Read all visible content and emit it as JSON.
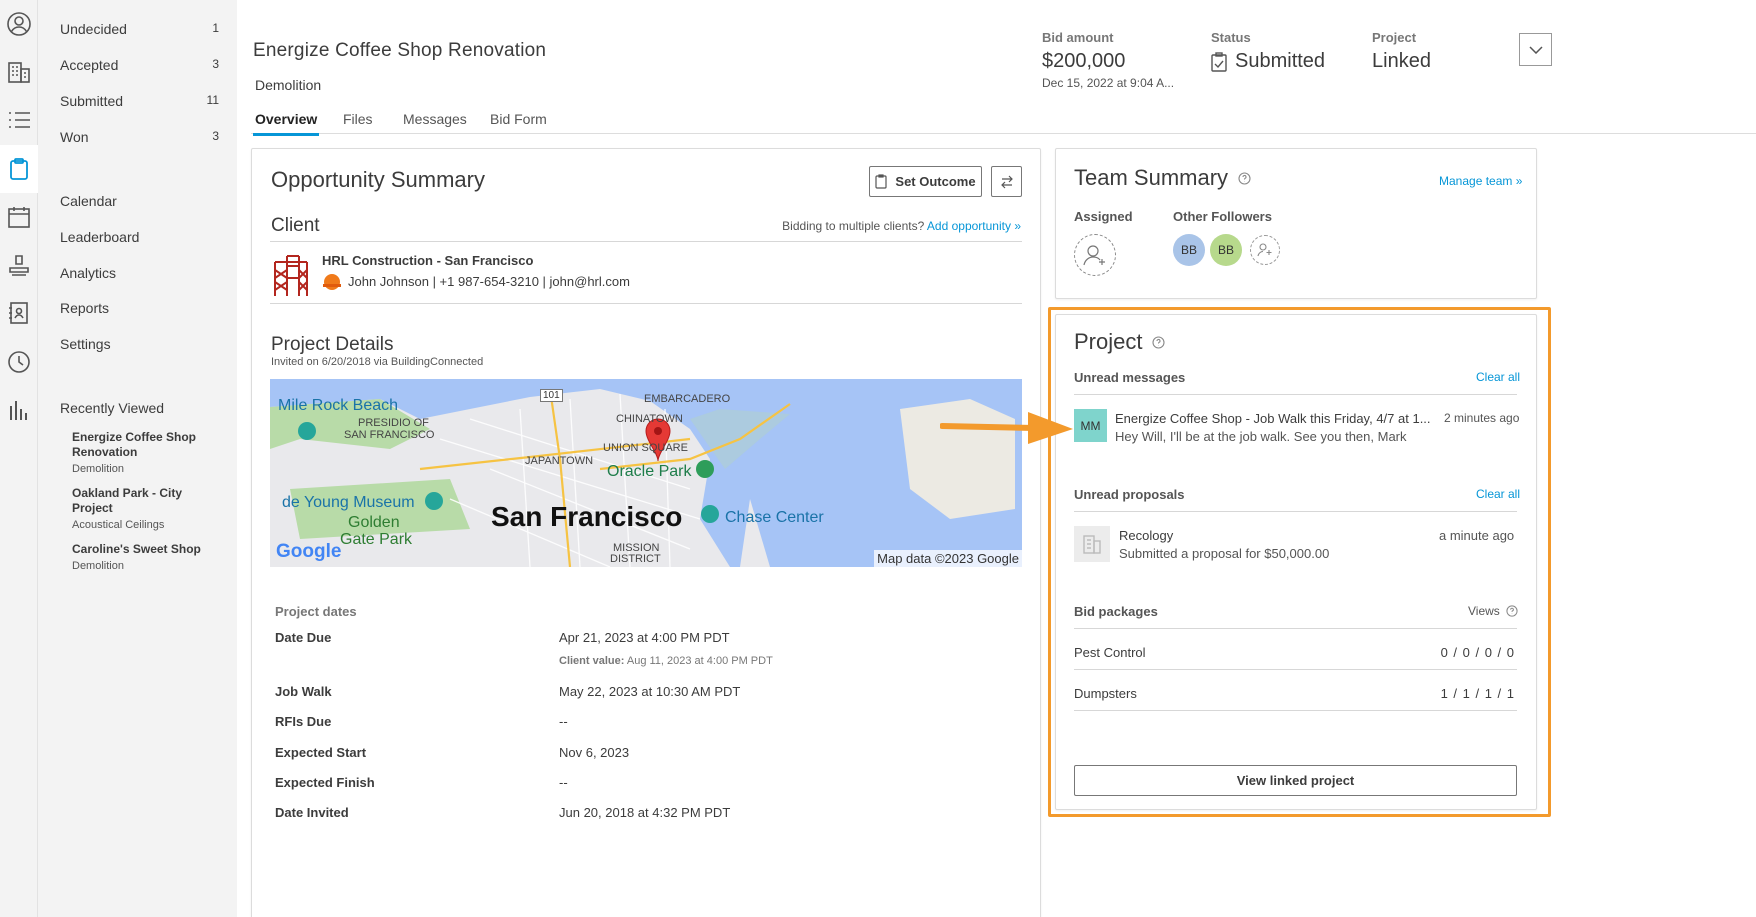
{
  "rail": {
    "icons": [
      "user-circle-icon",
      "building-icon",
      "list-icon",
      "clipboard-icon",
      "calendar-icon",
      "stamp-icon",
      "contacts-book-icon",
      "clock-icon",
      "bar-chart-icon"
    ]
  },
  "sidenav": {
    "items": [
      {
        "label": "Undecided",
        "count": "1"
      },
      {
        "label": "Accepted",
        "count": "3"
      },
      {
        "label": "Submitted",
        "count": "11"
      },
      {
        "label": "Won",
        "count": "3"
      }
    ],
    "links": [
      "Calendar",
      "Leaderboard",
      "Analytics",
      "Reports",
      "Settings"
    ],
    "recently_viewed_title": "Recently Viewed",
    "recent": [
      {
        "name": "Energize Coffee Shop Renovation",
        "sub": "Demolition"
      },
      {
        "name": "Oakland Park - City Project",
        "sub": "Acoustical Ceilings"
      },
      {
        "name": "Caroline's Sweet Shop",
        "sub": "Demolition"
      }
    ]
  },
  "header": {
    "title": "Energize Coffee Shop Renovation",
    "subtitle": "Demolition",
    "tabs": [
      "Overview",
      "Files",
      "Messages",
      "Bid Form"
    ],
    "bid_amount_label": "Bid amount",
    "bid_amount": "$200,000",
    "bid_date": "Dec 15, 2022 at 9:04 A...",
    "status_label": "Status",
    "status": "Submitted",
    "project_label": "Project",
    "project": "Linked"
  },
  "summary": {
    "title": "Opportunity Summary",
    "set_outcome": "Set Outcome",
    "client_heading": "Client",
    "multi_clients": "Bidding to multiple clients?",
    "add_opportunity": "Add opportunity »",
    "client_name": "HRL Construction - San Francisco",
    "contact": "John Johnson  |  +1 987-654-3210  |  john@hrl.com",
    "details_heading": "Project Details",
    "invited": "Invited on 6/20/2018 via BuildingConnected",
    "map": {
      "labels": [
        "Mile Rock Beach",
        "PRESIDIO OF",
        "SAN FRANCISCO",
        "EMBARCADERO",
        "CHINATOWN",
        "101",
        "JAPANTOWN",
        "UNION SQUARE",
        "Oracle Park",
        "de Young Museum",
        "Golden",
        "Gate Park",
        "San Francisco",
        "Chase Center",
        "MISSION",
        "DISTRICT"
      ],
      "attribution": "Map data ©2023 Google",
      "logo": "Google"
    },
    "dates_heading": "Project dates",
    "dates": [
      {
        "k": "Date Due",
        "v": "Apr 21, 2023 at 4:00 PM PDT"
      },
      {
        "k": "Job Walk",
        "v": "May 22, 2023 at 10:30 AM PDT"
      },
      {
        "k": "RFIs Due",
        "v": "--"
      },
      {
        "k": "Expected Start",
        "v": "Nov 6, 2023"
      },
      {
        "k": "Expected Finish",
        "v": "--"
      },
      {
        "k": "Date Invited",
        "v": "Jun 20, 2018 at 4:32 PM PDT"
      }
    ],
    "client_value_label": "Client value:",
    "client_value": "Aug 11, 2023 at 4:00 PM PDT"
  },
  "team": {
    "title": "Team Summary",
    "manage": "Manage team »",
    "assigned": "Assigned",
    "followers": "Other Followers",
    "avatars": [
      {
        "initials": "BB",
        "color": "#a9c4e8"
      },
      {
        "initials": "BB",
        "color": "#b7d98c"
      }
    ]
  },
  "project": {
    "title": "Project",
    "unread_messages": "Unread messages",
    "clear_all": "Clear all",
    "msg_avatar": "MM",
    "msg_subject": "Energize Coffee Shop - Job Walk this Friday, 4/7 at 1...",
    "msg_time": "2 minutes ago",
    "msg_body": "Hey Will, I'll be at the job walk. See you then, Mark",
    "unread_proposals": "Unread proposals",
    "proposal_company": "Recology",
    "proposal_time": "a minute ago",
    "proposal_text": "Submitted a proposal for $50,000.00",
    "bid_packages": "Bid packages",
    "views": "Views",
    "packages": [
      {
        "name": "Pest Control",
        "counts": "0 / 0 / 0 / 0"
      },
      {
        "name": "Dumpsters",
        "counts": "1 / 1 / 1 / 1"
      }
    ],
    "view_linked": "View linked project"
  },
  "colors": {
    "accent": "#0696d7",
    "highlight": "#f39a2c"
  }
}
